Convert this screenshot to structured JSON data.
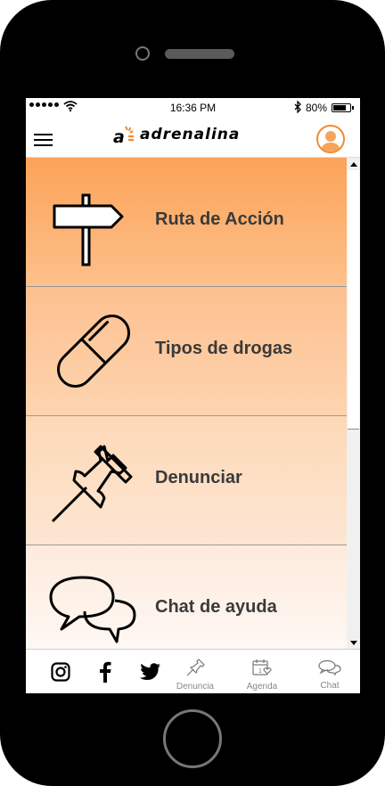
{
  "status": {
    "time": "16:36 PM",
    "battery": "80%",
    "battery_level": 0.8
  },
  "header": {
    "logo_text": "adrenalina",
    "accent_color": "#f28a2e"
  },
  "menu": [
    {
      "label": "Ruta de Acción",
      "icon": "signpost-icon"
    },
    {
      "label": "Tipos de drogas",
      "icon": "pill-icon"
    },
    {
      "label": "Denunciar",
      "icon": "pushpin-icon"
    },
    {
      "label": "Chat de ayuda",
      "icon": "chat-bubbles-icon"
    }
  ],
  "tabbar": {
    "social": [
      {
        "icon": "instagram-icon"
      },
      {
        "icon": "facebook-icon"
      },
      {
        "icon": "twitter-icon"
      }
    ],
    "tabs": [
      {
        "label": "Denuncia",
        "icon": "pushpin-icon"
      },
      {
        "label": "Agenda",
        "icon": "calendar-heart-icon"
      },
      {
        "label": "Chat",
        "icon": "chat-bubbles-icon"
      }
    ]
  }
}
